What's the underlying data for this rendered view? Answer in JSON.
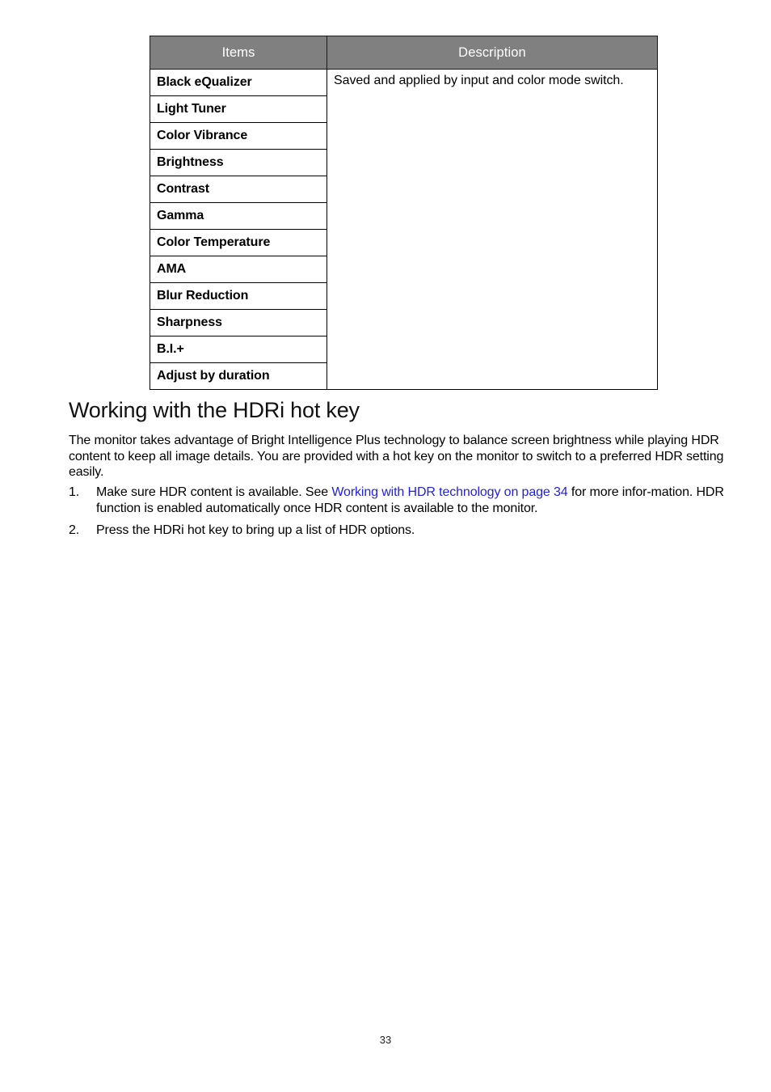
{
  "table": {
    "headers": {
      "items": "Items",
      "description": "Description"
    },
    "header_bg_color": "#808080",
    "rows": [
      {
        "item": "Black eQualizer",
        "description": "Saved and applied by input and color mode switch."
      },
      {
        "item": "Light Tuner",
        "description": ""
      },
      {
        "item": "Color Vibrance",
        "description": ""
      },
      {
        "item": "Brightness",
        "description": ""
      },
      {
        "item": "Contrast",
        "description": ""
      },
      {
        "item": "Gamma",
        "description": ""
      },
      {
        "item": "Color Temperature",
        "description": ""
      },
      {
        "item": "AMA",
        "description": ""
      },
      {
        "item": "Blur Reduction",
        "description": ""
      },
      {
        "item": "Sharpness",
        "description": ""
      },
      {
        "item": "B.I.+",
        "description": ""
      },
      {
        "item": "Adjust by duration",
        "description": ""
      }
    ]
  },
  "section": {
    "heading": "Working with the HDRi hot key",
    "intro": "The monitor takes advantage of Bright Intelligence Plus technology to balance screen brightness while playing HDR content to keep all image details. You are provided with a hot key on the monitor to switch to a preferred HDR setting easily.",
    "steps": [
      {
        "number": "1.",
        "text_before_link": "Make sure HDR content is available. See ",
        "link_text": "Working with HDR technology on page 34",
        "text_after_link": " for more infor-mation. HDR function is enabled automatically once HDR content is available to the monitor."
      },
      {
        "number": "2.",
        "text_before_link": "Press the HDRi hot key to bring up a list of HDR options.",
        "link_text": "",
        "text_after_link": ""
      }
    ],
    "link_color": "#2222dd"
  },
  "footer": {
    "page_number": "33"
  }
}
